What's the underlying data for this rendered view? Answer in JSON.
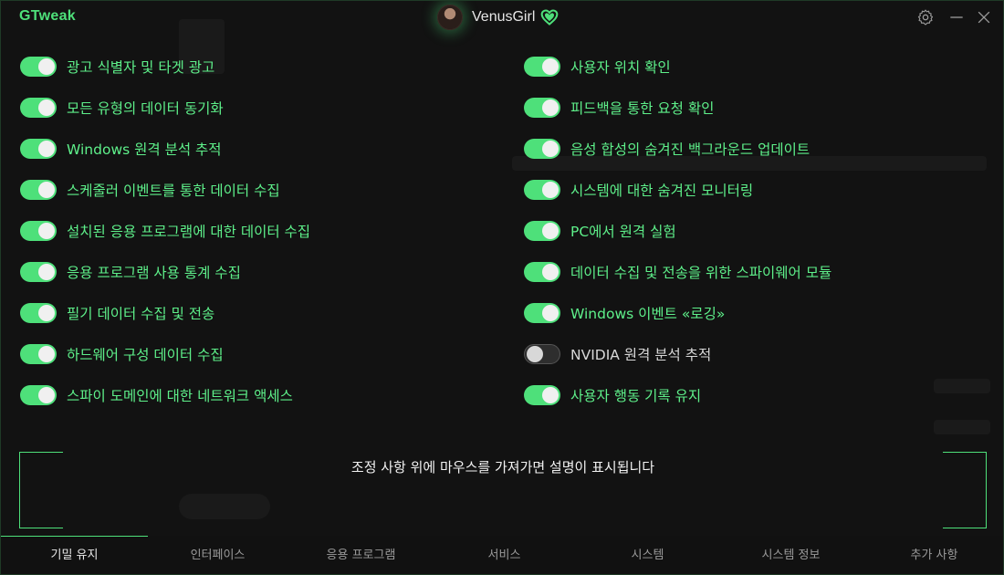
{
  "app_title": "GTweak",
  "user": {
    "name": "VenusGirl"
  },
  "colors": {
    "accent": "#4ee07a",
    "background": "#121212",
    "text": "#f2f2f2"
  },
  "icons": [
    "heart-icon",
    "gear-icon",
    "minimize-icon",
    "close-icon"
  ],
  "left_toggles": [
    {
      "label": "광고 식별자 및 타겟 광고",
      "on": true
    },
    {
      "label": "모든 유형의 데이터 동기화",
      "on": true
    },
    {
      "label": "Windows 원격 분석 추적",
      "on": true
    },
    {
      "label": "스케줄러 이벤트를 통한 데이터 수집",
      "on": true
    },
    {
      "label": "설치된 응용 프로그램에 대한 데이터 수집",
      "on": true
    },
    {
      "label": "응용 프로그램 사용 통계 수집",
      "on": true
    },
    {
      "label": "필기 데이터 수집 및 전송",
      "on": true
    },
    {
      "label": "하드웨어 구성 데이터 수집",
      "on": true
    },
    {
      "label": "스파이 도메인에 대한 네트워크 액세스",
      "on": true
    }
  ],
  "right_toggles": [
    {
      "label": "사용자 위치 확인",
      "on": true
    },
    {
      "label": "피드백을 통한 요청 확인",
      "on": true
    },
    {
      "label": "음성 합성의 숨겨진 백그라운드 업데이트",
      "on": true
    },
    {
      "label": "시스템에 대한 숨겨진 모니터링",
      "on": true
    },
    {
      "label": "PC에서 원격 실험",
      "on": true
    },
    {
      "label": "데이터 수집 및 전송을 위한 스파이웨어 모듈",
      "on": true
    },
    {
      "label": "Windows 이벤트 «로깅»",
      "on": true
    },
    {
      "label": "NVIDIA 원격 분석 추적",
      "on": false
    },
    {
      "label": "사용자 행동 기록 유지",
      "on": true
    }
  ],
  "description": "조정 사항 위에 마우스를 가져가면 설명이 표시됩니다",
  "tabs": [
    {
      "label": "기밀 유지",
      "active": true
    },
    {
      "label": "인터페이스",
      "active": false
    },
    {
      "label": "응용 프로그램",
      "active": false
    },
    {
      "label": "서비스",
      "active": false
    },
    {
      "label": "시스템",
      "active": false
    },
    {
      "label": "시스템 정보",
      "active": false
    },
    {
      "label": "추가 사항",
      "active": false
    }
  ]
}
